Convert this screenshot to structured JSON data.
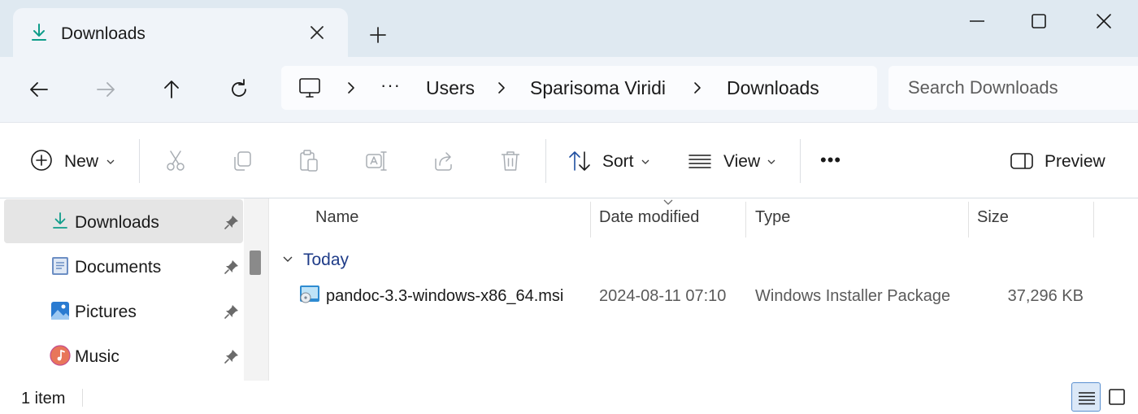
{
  "window": {
    "tab_title": "Downloads",
    "tab_icon": "download-icon",
    "new_tab_icon": "plus-icon",
    "controls": [
      "minimize-icon",
      "maximize-icon",
      "close-icon"
    ]
  },
  "navigation": {
    "back_icon": "arrow-left-icon",
    "forward_icon": "arrow-right-icon",
    "up_icon": "arrow-up-icon",
    "refresh_icon": "refresh-icon"
  },
  "address": {
    "root_icon": "this-pc-icon",
    "overflow": "···",
    "crumbs": [
      "Users",
      "Sparisoma Viridi",
      "Downloads"
    ]
  },
  "search": {
    "placeholder": "Search Downloads"
  },
  "toolbar": {
    "new_label": "New",
    "sort_label": "Sort",
    "view_label": "View",
    "more_label": "•••",
    "preview_label": "Preview",
    "disabled_actions": [
      "cut",
      "copy",
      "paste",
      "rename",
      "share",
      "delete"
    ]
  },
  "sidebar": {
    "items": [
      {
        "label": "Downloads",
        "icon": "download-icon",
        "active": true,
        "pinned": true
      },
      {
        "label": "Documents",
        "icon": "documents-icon",
        "active": false,
        "pinned": true
      },
      {
        "label": "Pictures",
        "icon": "pictures-icon",
        "active": false,
        "pinned": true
      },
      {
        "label": "Music",
        "icon": "music-icon",
        "active": false,
        "pinned": true
      }
    ]
  },
  "filelist": {
    "columns": [
      "Name",
      "Date modified",
      "Type",
      "Size"
    ],
    "sort_column": "Date modified",
    "group_label": "Today",
    "rows": [
      {
        "name": "pandoc-3.3-windows-x86_64.msi",
        "date": "2024-08-11 07:10",
        "type": "Windows Installer Package",
        "size": "37,296 KB",
        "icon": "msi-installer-icon"
      }
    ]
  },
  "status": {
    "item_count": "1 item",
    "active_view": "details"
  },
  "colors": {
    "titlebar": "#dfe9f1",
    "toolbar_bg": "#f0f4f9",
    "accent": "#0f9d8a",
    "group_text": "#1f3c88",
    "selection": "#e5e5e5"
  }
}
